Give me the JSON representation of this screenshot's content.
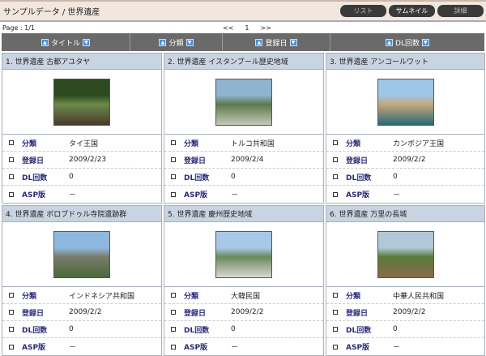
{
  "header": {
    "title": "サンプルデータ / 世界遺産",
    "buttons": [
      "リスト",
      "サムネイル",
      "詳細"
    ]
  },
  "pager": {
    "page": "Page : 1/1",
    "prev": "<<",
    "current": "1",
    "next": ">>"
  },
  "sort": [
    "タイトル",
    "分類",
    "登録日",
    "DL回数"
  ],
  "labels": {
    "category": "分類",
    "date": "登録日",
    "dl": "DL回数",
    "asp": "ASP版"
  },
  "items": [
    {
      "title": "1. 世界遺産 古都アユタヤ",
      "category": "タイ王国",
      "date": "2009/2/23",
      "dl": "0",
      "asp": "－",
      "colors": [
        "#2d4a1e",
        "#6b8a4a",
        "#4a3a2a"
      ]
    },
    {
      "title": "2. 世界遺産 イスタンブール歴史地域",
      "category": "トルコ共和国",
      "date": "2009/2/4",
      "dl": "0",
      "asp": "－",
      "colors": [
        "#8fb4cf",
        "#5a7a4a",
        "#c8c8b8"
      ]
    },
    {
      "title": "3. 世界遺産 アンコールワット",
      "category": "カンボジア王国",
      "date": "2009/2/2",
      "dl": "0",
      "asp": "－",
      "colors": [
        "#9fc6e4",
        "#c4a67a",
        "#2a6a7a"
      ]
    },
    {
      "title": "4. 世界遺産 ボロブドゥル寺院遺跡群",
      "category": "インドネシア共和国",
      "date": "2009/2/2",
      "dl": "0",
      "asp": "－",
      "colors": [
        "#8fb8e0",
        "#7a7a6a",
        "#4a6a3a"
      ]
    },
    {
      "title": "5. 世界遺産 慶州歴史地域",
      "category": "大韓民国",
      "date": "2009/2/2",
      "dl": "0",
      "asp": "－",
      "colors": [
        "#a8c8e8",
        "#6a8a5a",
        "#d8d8d0"
      ]
    },
    {
      "title": "6. 世界遺産 万里の長城",
      "category": "中華人民共和国",
      "date": "2009/2/2",
      "dl": "0",
      "asp": "－",
      "colors": [
        "#b0c8d8",
        "#5a7a3a",
        "#8a6a4a"
      ]
    }
  ]
}
